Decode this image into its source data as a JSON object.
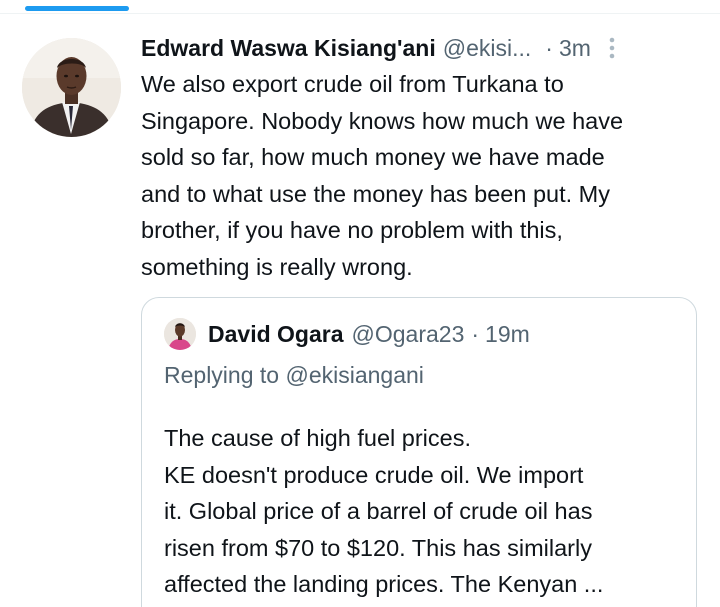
{
  "tweet": {
    "author_name": "Edward Waswa Kisiang'ani",
    "author_handle": "@ekisi...",
    "separator": "·",
    "time": "3m",
    "avatar_icon": "user-photo",
    "more_icon": "more-vertical-icon",
    "text": "We also export crude oil from Turkana to\nSingapore. Nobody knows how much we have\nsold so far, how much money we have made\nand to what use the money has been put. My\nbrother, if you have no problem with this,\nsomething is really wrong."
  },
  "quoted_tweet": {
    "author_name": "David Ogara",
    "author_handle": "@Ogara23",
    "separator": "·",
    "time": "19m",
    "avatar_icon": "user-photo",
    "replying_prefix": "Replying to",
    "replying_handle": "@ekisiangani",
    "text": "The cause of high fuel prices.\nKE doesn't produce crude oil. We import\nit. Global price of a barrel of crude oil has\nrisen from $70 to $120. This has similarly\naffected the landing prices. The Kenyan ..."
  },
  "colors": {
    "accent": "#1d9bf0",
    "text_primary": "#0f1419",
    "text_secondary": "#536471",
    "border": "#cfd9de"
  }
}
